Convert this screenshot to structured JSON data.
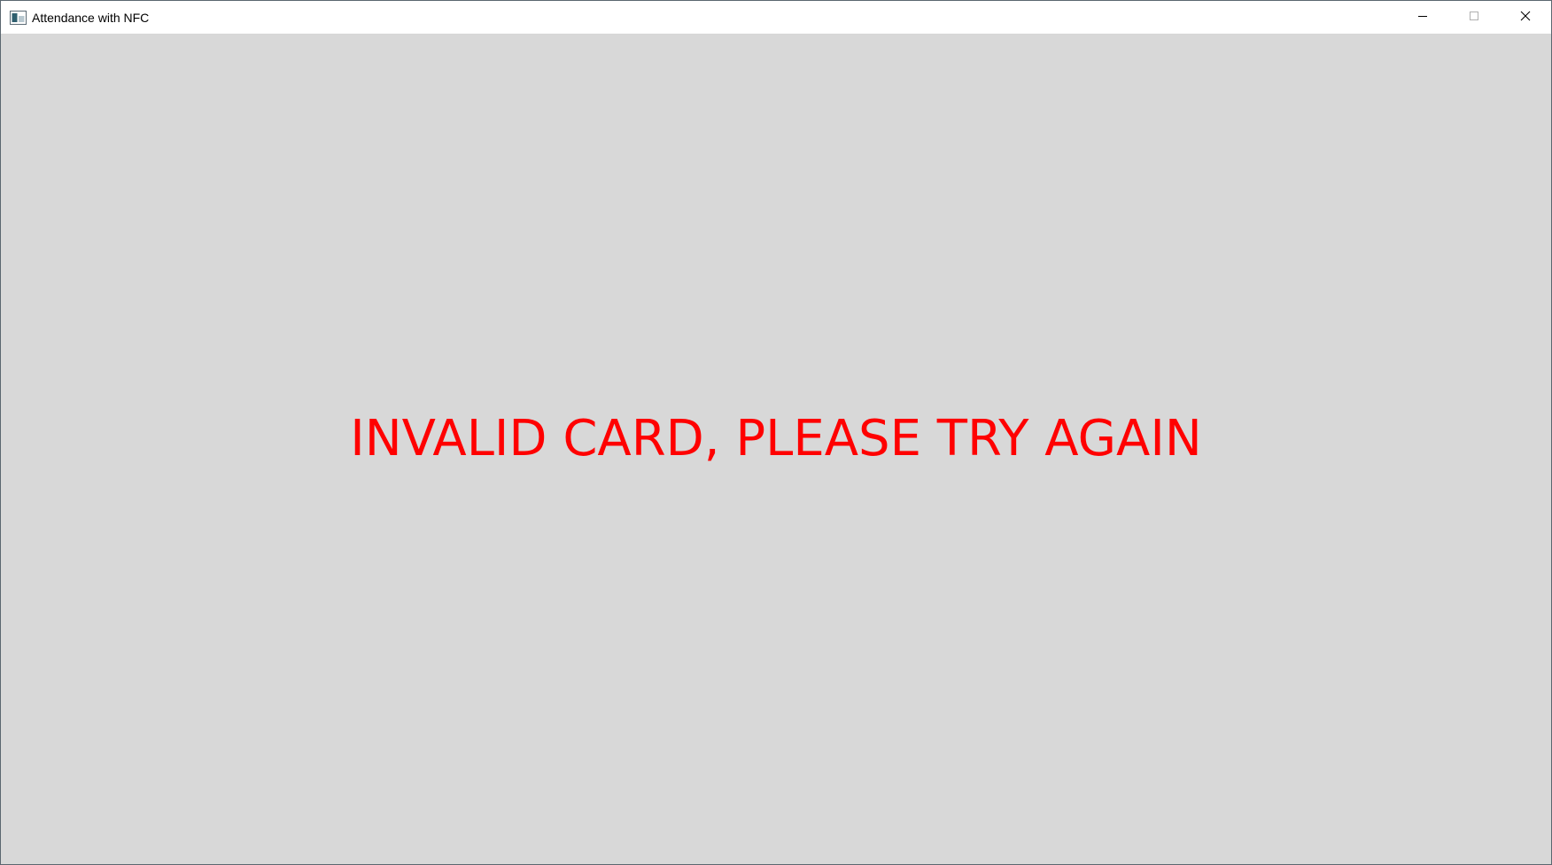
{
  "window": {
    "title": "Attendance with NFC",
    "app_icon": "window-app-icon",
    "background_color": "#d8d8d8",
    "titlebar_color": "#ffffff",
    "controls": {
      "minimize_icon": "minimize-icon",
      "maximize_icon": "maximize-icon",
      "close_icon": "close-icon"
    }
  },
  "main": {
    "message": "INVALID CARD, PLEASE TRY AGAIN",
    "message_color": "#ff0000"
  }
}
